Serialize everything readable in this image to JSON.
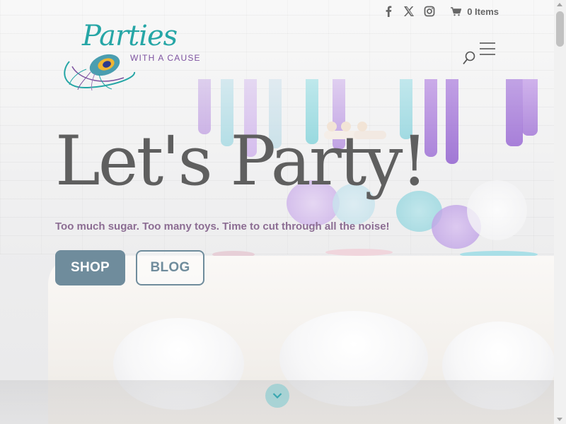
{
  "header": {
    "social": [
      {
        "icon": "facebook-icon"
      },
      {
        "icon": "x-twitter-icon"
      },
      {
        "icon": "instagram-icon"
      }
    ],
    "cart": {
      "icon": "cart-icon",
      "label": "0 Items"
    },
    "logo": {
      "brand": "Parties",
      "tagline": "WITH A CAUSE",
      "icon": "peacock-feather-icon"
    },
    "search_icon": "search-icon",
    "menu_icon": "hamburger-menu-icon"
  },
  "hero": {
    "headline": "Let's Party!",
    "tagline": "Too much sugar. Too many toys. Time to cut through all the noise!",
    "buttons": {
      "shop": "SHOP",
      "blog": "BLOG"
    },
    "scroll_icon": "chevron-down-icon"
  },
  "colors": {
    "logo_teal": "#26a6a6",
    "logo_purple": "#7d52a0",
    "headline": "#5f5f5f",
    "tagline": "#8c6d93",
    "button": "#6f8c9c"
  }
}
